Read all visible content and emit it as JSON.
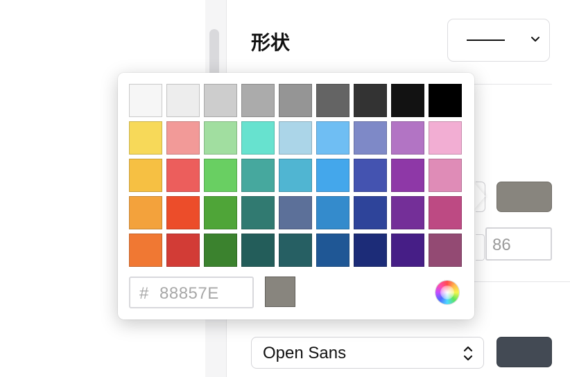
{
  "properties_panel": {
    "shape_label": "形状",
    "stroke_width_value": "86",
    "font_family_value": "Open Sans",
    "fill_color": "#88857E",
    "text_color": "#434A54"
  },
  "color_picker": {
    "hash_symbol": "#",
    "hex_value": "88857E",
    "preview_color": "#88857E",
    "swatches": [
      [
        "#F6F6F6",
        "#EDEDED",
        "#CDCDCD",
        "#ABABAB",
        "#959595",
        "#646464",
        "#333333",
        "#121212",
        "#000000"
      ],
      [
        "#F7D959",
        "#F29A98",
        "#A1DEA0",
        "#67E2CF",
        "#ABD5E8",
        "#6FBEF3",
        "#7E89C7",
        "#B274C4",
        "#F2AED3"
      ],
      [
        "#F6C043",
        "#EC5E5C",
        "#69CF62",
        "#46A89E",
        "#50B5D2",
        "#44A7EB",
        "#4453B0",
        "#8E38A7",
        "#DF8CB7"
      ],
      [
        "#F3A23C",
        "#EC4D2A",
        "#4FA538",
        "#317A71",
        "#5C7099",
        "#348BCC",
        "#2E449A",
        "#742F98",
        "#BD4A83"
      ],
      [
        "#F07833",
        "#D23C36",
        "#3B822E",
        "#235D5A",
        "#265F63",
        "#1F5795",
        "#1C2C78",
        "#461E86",
        "#934A73"
      ]
    ]
  }
}
